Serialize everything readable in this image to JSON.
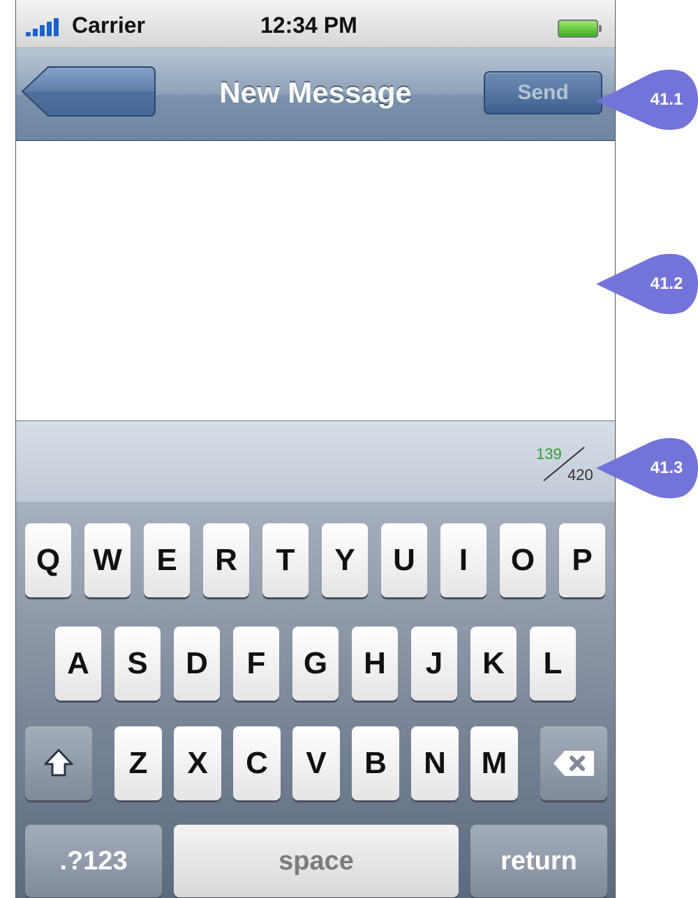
{
  "status_bar": {
    "carrier": "Carrier",
    "time": "12:34 PM"
  },
  "nav": {
    "title": "New Message",
    "send_label": "Send"
  },
  "message": {
    "text": ""
  },
  "counter": {
    "used": "139",
    "max": "420"
  },
  "keyboard": {
    "row1": [
      "Q",
      "W",
      "E",
      "R",
      "T",
      "Y",
      "U",
      "I",
      "O",
      "P"
    ],
    "row2": [
      "A",
      "S",
      "D",
      "F",
      "G",
      "H",
      "J",
      "K",
      "L"
    ],
    "row3": [
      "Z",
      "X",
      "C",
      "V",
      "B",
      "N",
      "M"
    ],
    "numbers_label": ".?123",
    "space_label": "space",
    "return_label": "return"
  },
  "callouts": [
    "41.1",
    "41.2",
    "41.3"
  ],
  "colors": {
    "callout": "#7373d9",
    "nav": "#8da1b8",
    "send": "#3f6192",
    "counter_used": "#2f9e2f"
  },
  "icons": {
    "shift": "shift-icon",
    "delete": "backspace-icon"
  }
}
